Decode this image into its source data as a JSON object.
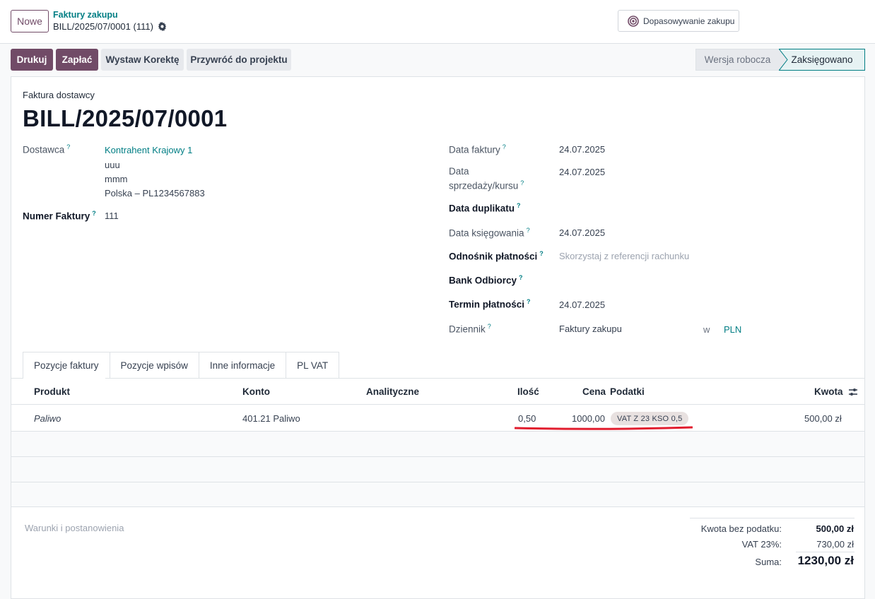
{
  "topbar": {
    "new_label": "Nowe",
    "breadcrumb_parent": "Faktury zakupu",
    "breadcrumb_current": "BILL/2025/07/0001 (111)",
    "match_button": "Dopasowywanie zakupu"
  },
  "actions": {
    "print": "Drukuj",
    "pay": "Zapłać",
    "credit_note": "Wystaw Korektę",
    "reset_draft": "Przywróć do projektu"
  },
  "status": {
    "draft": "Wersja robocza",
    "posted": "Zaksięgowano",
    "active": "posted"
  },
  "document": {
    "type": "Faktura dostawcy",
    "number": "BILL/2025/07/0001"
  },
  "left_fields": {
    "vendor_label": "Dostawca",
    "vendor_name": "Kontrahent Krajowy 1",
    "vendor_line2": "uuu",
    "vendor_line3": "mmm",
    "vendor_line4": "Polska – PL1234567883",
    "invoice_number_label": "Numer Faktury",
    "invoice_number": "111"
  },
  "right_fields": {
    "invoice_date_label": "Data faktury",
    "invoice_date": "24.07.2025",
    "sale_date_label_1": "Data",
    "sale_date_label_2": "sprzedaży/kursu",
    "sale_date": "24.07.2025",
    "duplicate_date_label": "Data duplikatu",
    "accounting_date_label": "Data księgowania",
    "accounting_date": "24.07.2025",
    "payment_ref_label": "Odnośnik płatności",
    "payment_ref_placeholder": "Skorzystaj z referencji rachunku",
    "bank_label": "Bank Odbiorcy",
    "due_date_label": "Termin płatności",
    "due_date": "24.07.2025",
    "journal_label": "Dziennik",
    "journal": "Faktury zakupu",
    "in_word": "w",
    "currency": "PLN"
  },
  "tabs": [
    {
      "label": "Pozycje faktury",
      "active": true
    },
    {
      "label": "Pozycje wpisów",
      "active": false
    },
    {
      "label": "Inne informacje",
      "active": false
    },
    {
      "label": "PL VAT",
      "active": false
    }
  ],
  "table": {
    "headers": {
      "product": "Produkt",
      "account": "Konto",
      "analytic": "Analityczne",
      "quantity": "Ilość",
      "price": "Cena",
      "taxes": "Podatki",
      "amount": "Kwota"
    },
    "rows": [
      {
        "product": "Paliwo",
        "account": "401.21 Paliwo",
        "analytic": "",
        "quantity": "0,50",
        "price": "1000,00",
        "tax": "VAT Z 23 KSO 0,5",
        "amount": "500,00 zł"
      }
    ]
  },
  "footer": {
    "terms_placeholder": "Warunki i postanowienia",
    "untaxed_label": "Kwota bez podatku:",
    "untaxed_value": "500,00 zł",
    "vat_label": "VAT 23%:",
    "vat_value": "730,00 zł",
    "total_label": "Suma:",
    "total_value": "1230,00 zł"
  },
  "colors": {
    "brand": "#714b67",
    "link": "#017e84",
    "annotation": "#e11d2e"
  }
}
